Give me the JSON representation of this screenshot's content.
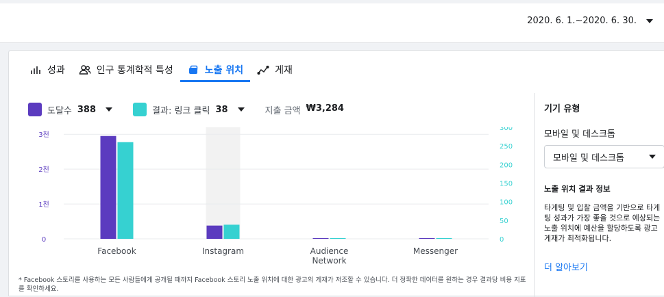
{
  "header": {
    "date_range": "2020. 6. 1.~2020. 6. 30."
  },
  "tabs": [
    {
      "label": "성과",
      "icon": "bar-chart-icon"
    },
    {
      "label": "인구 통계학적 특성",
      "icon": "people-icon"
    },
    {
      "label": "노출 위치",
      "icon": "placement-icon",
      "active": true
    },
    {
      "label": "게재",
      "icon": "delivery-icon"
    }
  ],
  "metrics": {
    "reach": {
      "label": "도달수",
      "value": "388",
      "color": "#5b3bbf"
    },
    "results": {
      "label": "결과: 링크 클릭",
      "value": "38",
      "color": "#36d1d1"
    },
    "spend": {
      "label": "지출 금액",
      "value": "₩3,284"
    }
  },
  "chart_data": {
    "type": "bar",
    "categories": [
      "Facebook",
      "Instagram",
      "Audience\nNetwork",
      "Messenger"
    ],
    "series": [
      {
        "name": "도달수",
        "axis": "left",
        "color": "#5b3bbf",
        "values": [
          2950,
          380,
          10,
          10
        ]
      },
      {
        "name": "결과: 링크 클릭",
        "axis": "right",
        "color": "#36d1d1",
        "values": [
          260,
          38,
          1,
          1
        ]
      }
    ],
    "left_axis": {
      "ticks": [
        "0",
        "1천",
        "2천",
        "3천"
      ],
      "tick_values": [
        0,
        1000,
        2000,
        3000
      ],
      "ylim": [
        0,
        3200
      ]
    },
    "right_axis": {
      "ticks": [
        "0",
        "50",
        "100",
        "150",
        "200",
        "250",
        "300"
      ],
      "tick_values": [
        0,
        50,
        100,
        150,
        200,
        250,
        300
      ],
      "ylim": [
        0,
        300
      ]
    },
    "highlighted_category": "Instagram",
    "grid": true
  },
  "footnote": "* Facebook 스토리를 사용하는 모든 사람들에게 공개될 때까지 Facebook 스토리 노출 위치에 대한 광고의 게재가 저조할 수 있습니다. 더 정확한 데이터를 원하는 경우 결과당 비용 지표를 확인하세요.",
  "side": {
    "title": "기기 유형",
    "subtitle": "모바일 및 데스크톱",
    "select_value": "모바일 및 데스크톱",
    "info_title": "노출 위치 결과 정보",
    "info_body": "타게팅 및 입찰 금액을 기반으로 타게팅 성과가 가장 좋을 것으로 예상되는 노출 위치에 예산을 할당하도록 광고 게재가 최적화됩니다.",
    "learn_more": "더 알아보기"
  }
}
